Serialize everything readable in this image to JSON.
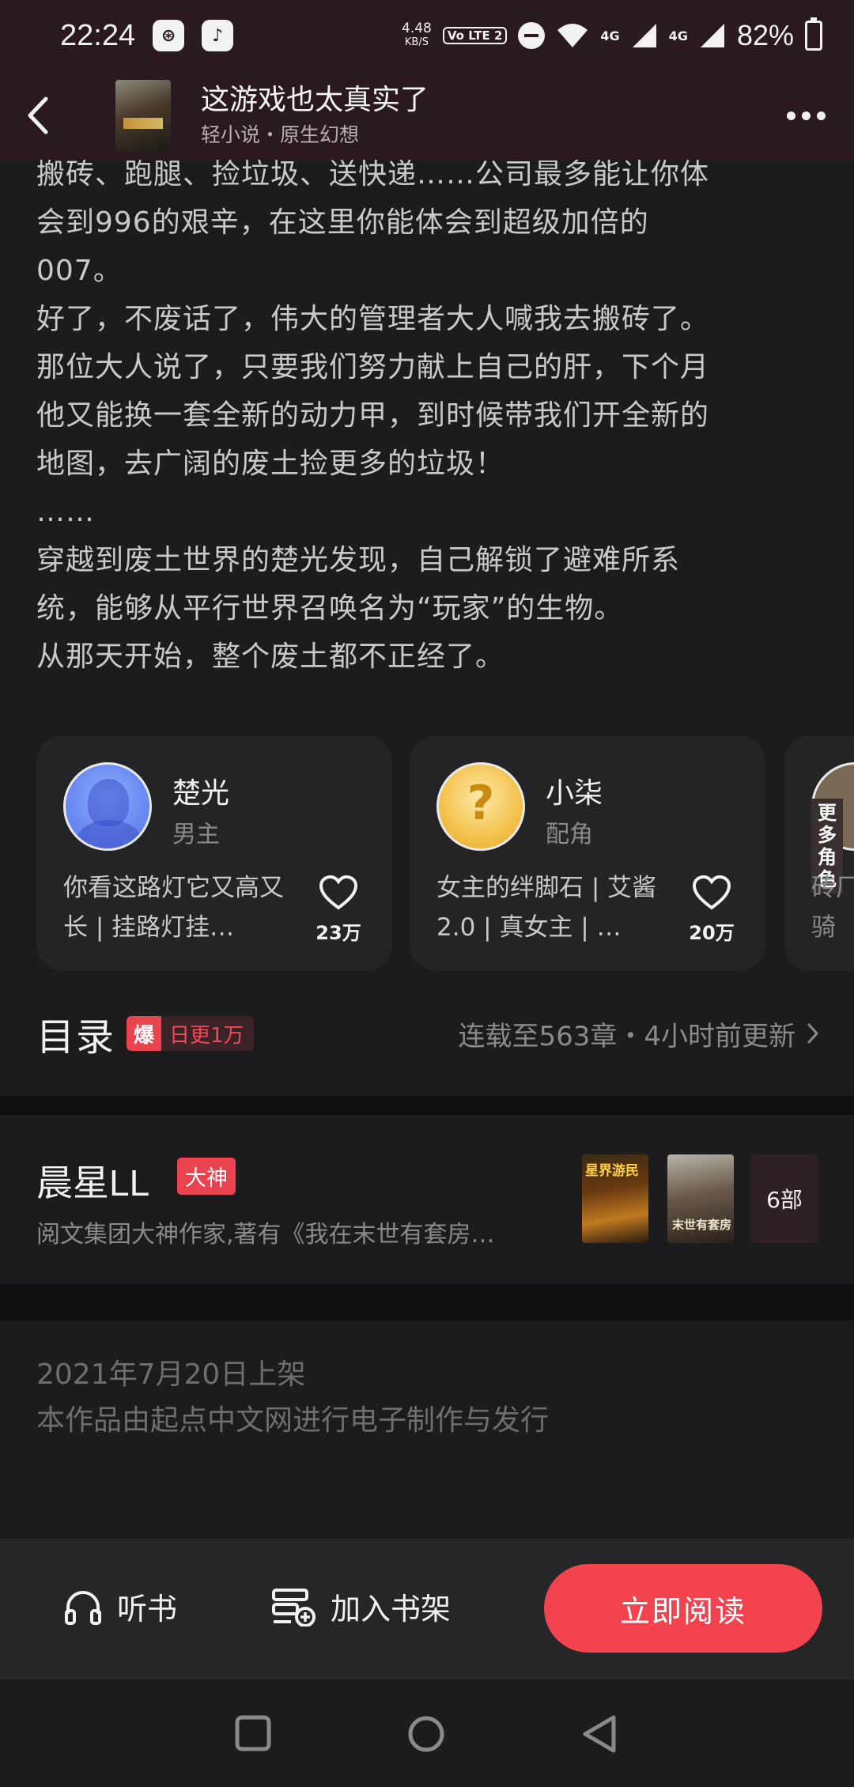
{
  "status": {
    "time": "22:24",
    "net_speed_value": "4.48",
    "net_speed_unit": "KB/S",
    "volte_label": "Vo LTE 2",
    "signal_label_1": "4G",
    "signal_label_2": "4G",
    "battery": "82%"
  },
  "header": {
    "title": "这游戏也太真实了",
    "subtitle": "轻小说・原生幻想"
  },
  "synopsis": {
    "lines": [
      "搬砖、跑腿、捡垃圾、送快递……公司最多能让你体",
      "会到996的艰辛，在这里你能体会到超级加倍的",
      "007。",
      "好了，不废话了，伟大的管理者大人喊我去搬砖了。",
      "那位大人说了，只要我们努力献上自己的肝，下个月",
      "他又能换一套全新的动力甲，到时候带我们开全新的",
      "地图，去广阔的废土捡更多的垃圾！",
      "……",
      "穿越到废土世界的楚光发现，自己解锁了避难所系",
      "统，能够从平行世界召唤名为“玩家”的生物。",
      "从那天开始，整个废土都不正经了。"
    ]
  },
  "characters": [
    {
      "name": "楚光",
      "role": "男主",
      "desc": "你看这路灯它又高又长 | 挂路灯挂…",
      "likes": "23万"
    },
    {
      "name": "小柒",
      "role": "配角",
      "desc": "女主的绊脚石 | 艾酱2.0 | 真女主 | …",
      "likes": "20万"
    }
  ],
  "more_characters": {
    "label": "更多角色",
    "peek_desc": "砖厂白骑"
  },
  "catalog": {
    "title": "目录",
    "hot_icon": "爆",
    "hot_text": "日更1万",
    "status": "连载至563章・4小时前更新"
  },
  "author": {
    "name": "晨星LL",
    "badge": "大神",
    "desc": "阅文集团大神作家,著有《我在末世有套房…",
    "book1_caption": "星界游民",
    "book2_caption": "末世有套房",
    "more_books": "6部"
  },
  "publish": {
    "date": "2021年7月20日上架",
    "note": "本作品由起点中文网进行电子制作与发行"
  },
  "actions": {
    "listen": "听书",
    "shelf": "加入书架",
    "read": "立即阅读"
  },
  "colors": {
    "accent": "#f2434f",
    "background": "#1c1c1e",
    "card": "#242426",
    "header": "#2a1a20"
  }
}
